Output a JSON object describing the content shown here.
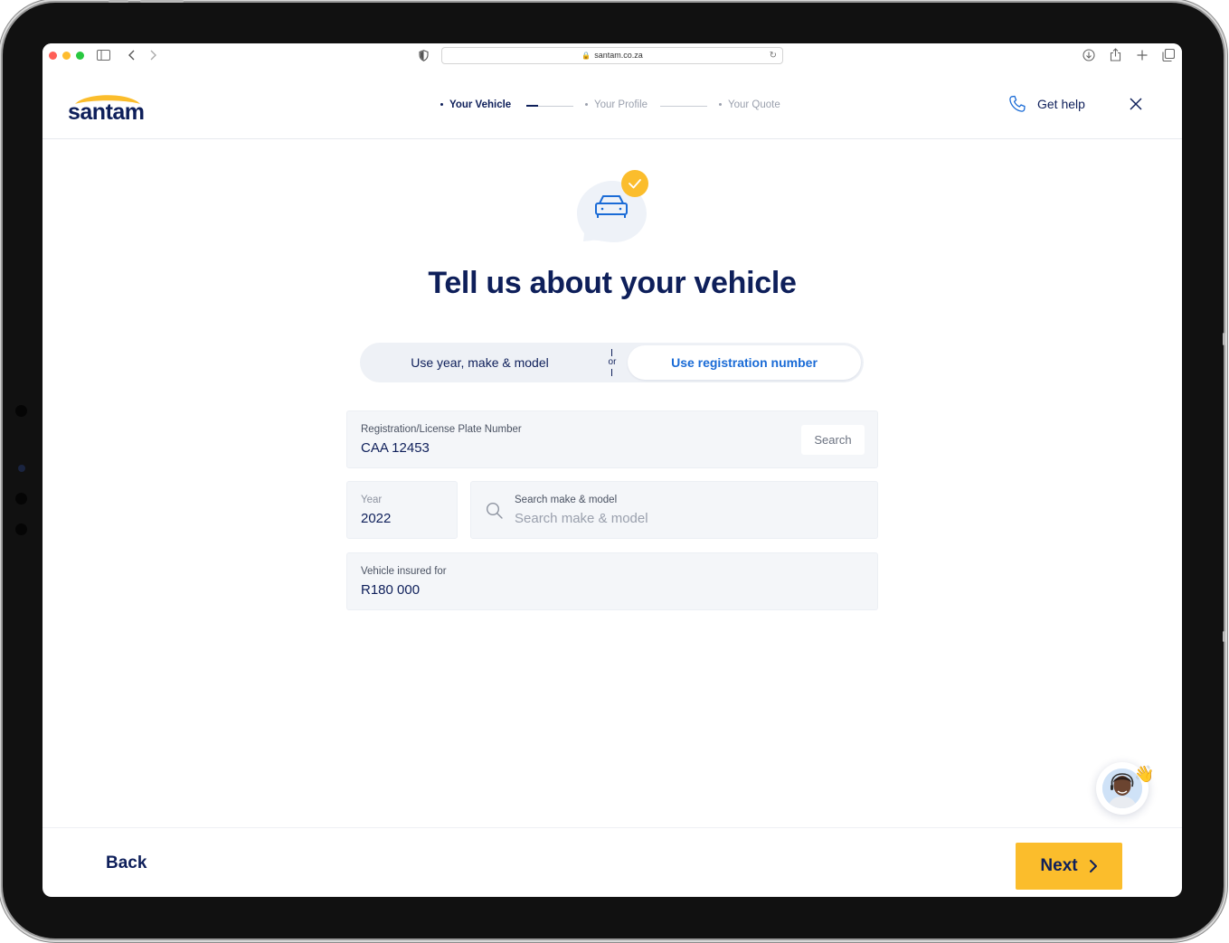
{
  "browser": {
    "url": "santam.co.za",
    "traffic_lights": [
      "#ff5f57",
      "#febc2e",
      "#28c840"
    ]
  },
  "header": {
    "logo_text": "santam",
    "brand_color": "#0e1f5a",
    "accent_color": "#fbbd2c",
    "steps": [
      {
        "label": "Your Vehicle",
        "active": true
      },
      {
        "label": "Your Profile",
        "active": false
      },
      {
        "label": "Your Quote",
        "active": false
      }
    ],
    "help_label": "Get help"
  },
  "main": {
    "title": "Tell us about your vehicle",
    "toggle": {
      "left_label": "Use year, make & model",
      "or_label": "or",
      "right_label": "Use registration number",
      "selected": "right"
    },
    "registration": {
      "label": "Registration/License Plate Number",
      "value": "CAA 12453",
      "button_label": "Search"
    },
    "year": {
      "label": "Year",
      "value": "2022"
    },
    "make_model": {
      "label": "Search make & model",
      "placeholder": "Search make & model"
    },
    "insured": {
      "label": "Vehicle insured for",
      "value": "R180 000"
    }
  },
  "footer": {
    "back_label": "Back",
    "next_label": "Next"
  }
}
